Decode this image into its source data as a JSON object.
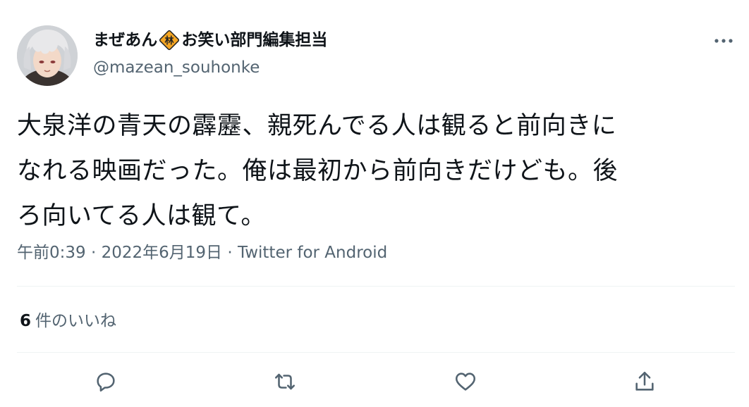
{
  "author": {
    "display_name_prefix": "まぜあん",
    "badge_text": "林",
    "display_name_suffix": "お笑い部門編集担当",
    "handle": "@mazean_souhonke"
  },
  "tweet": {
    "text_lines": [
      "大泉洋の青天の霹靂、親死んでる人は観ると前向きに",
      "なれる映画だった。俺は最初から前向きだけども。後",
      "ろ向いてる人は観て。"
    ],
    "time": "午前0:39",
    "separator": "·",
    "date": "2022年6月19日",
    "source": "Twitter for Android"
  },
  "engagement": {
    "likes_count": "6",
    "likes_label": "件のいいね"
  },
  "actions": {
    "icons": [
      "reply-icon",
      "retweet-icon",
      "like-icon",
      "share-icon"
    ]
  },
  "colors": {
    "text_primary": "#0f1419",
    "text_secondary": "#536471",
    "divider": "#eff3f4",
    "badge_fill": "#f5a623"
  }
}
